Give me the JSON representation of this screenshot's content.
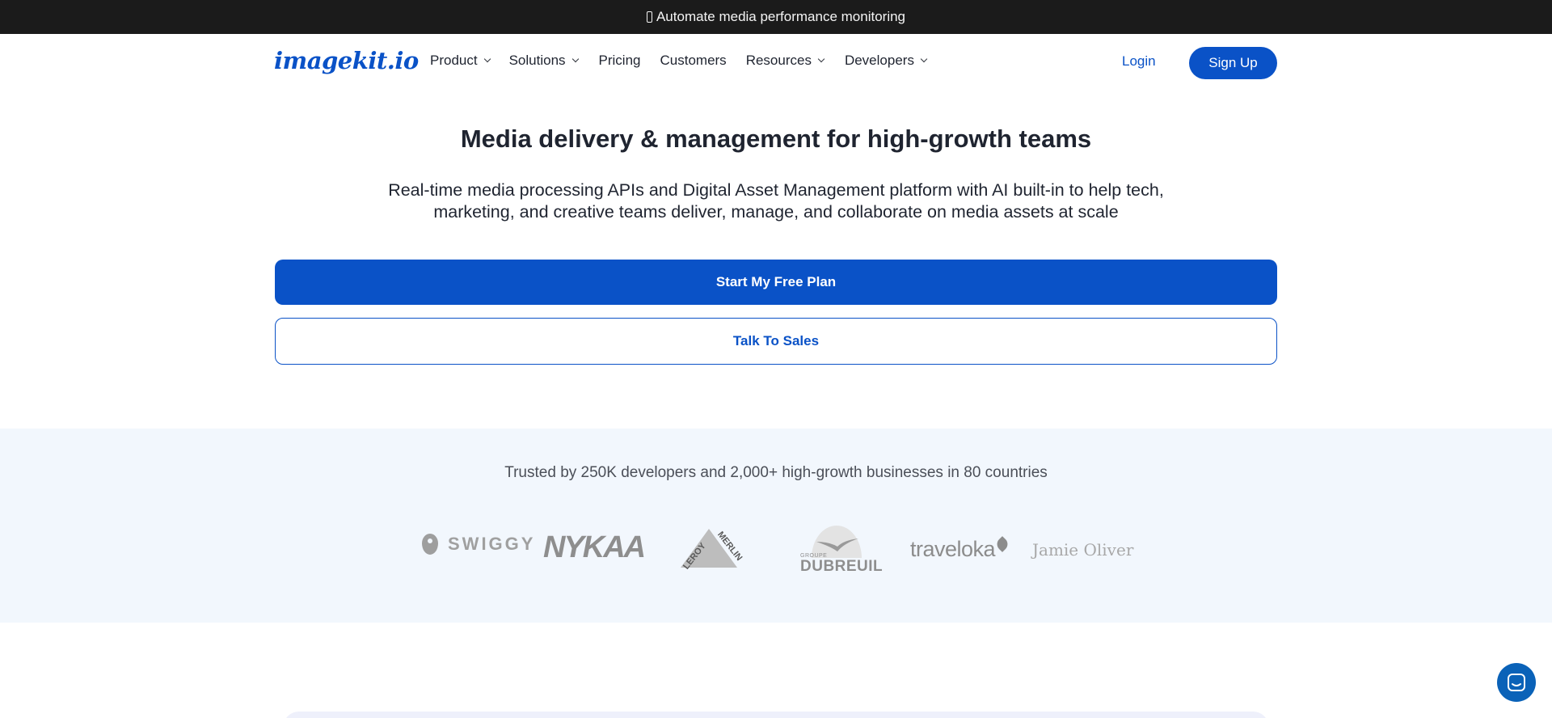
{
  "announcement": {
    "text": "Automate media performance monitoring",
    "icon": "lightbulb-icon"
  },
  "nav": {
    "logo": "imagekit.io",
    "menu": [
      {
        "label": "Product",
        "dropdown": true
      },
      {
        "label": "Solutions",
        "dropdown": true
      },
      {
        "label": "Pricing",
        "dropdown": false
      },
      {
        "label": "Customers",
        "dropdown": false
      },
      {
        "label": "Resources",
        "dropdown": true
      },
      {
        "label": "Developers",
        "dropdown": true
      }
    ],
    "login_label": "Login",
    "signup_label": "Sign Up"
  },
  "hero": {
    "title": "Media delivery & management for high-growth teams",
    "subtitle_line1": "Real-time media processing APIs and Digital Asset Management platform with AI built-in to help tech,",
    "subtitle_line2": "marketing, and creative teams deliver, manage, and collaborate on media assets at scale",
    "primary_cta": "Start My Free Plan",
    "secondary_cta": "Talk To Sales"
  },
  "trust": {
    "text": "Trusted by 250K developers and 2,000+ high-growth businesses in 80 countries",
    "logos": {
      "swiggy": "SWIGGY",
      "nykaa": "NYKAA",
      "leroy_1": "LEROY",
      "leroy_2": "MERLIN",
      "dubreuil_group": "GROUPE",
      "dubreuil": "DUBREUIL",
      "traveloka": "traveloka",
      "jamie": "Jamie Oliver"
    }
  },
  "colors": {
    "brand": "#0a52c7",
    "dark_bar": "#1b1b1b",
    "trust_bg": "#f2f7fd",
    "logo_gray": "#9a9a9a"
  },
  "chat": {
    "icon": "chat-icon"
  }
}
